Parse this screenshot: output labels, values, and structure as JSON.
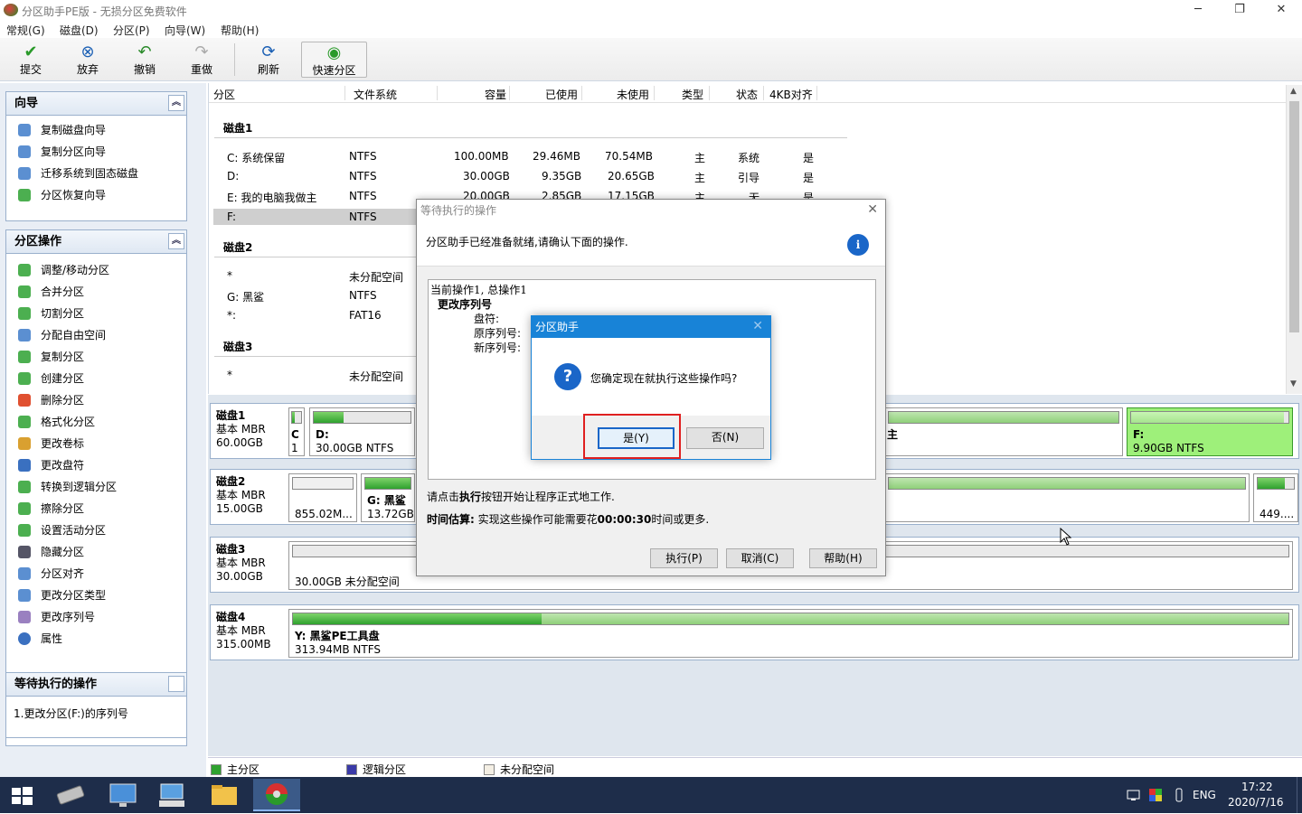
{
  "window": {
    "title": "分区助手PE版 - 无损分区免费软件",
    "minimize": "─",
    "restore": "❐",
    "close": "✕"
  },
  "menu": [
    "常规(G)",
    "磁盘(D)",
    "分区(P)",
    "向导(W)",
    "帮助(H)"
  ],
  "toolbar": {
    "commit": "提交",
    "discard": "放弃",
    "undo": "撤销",
    "redo": "重做",
    "refresh": "刷新",
    "quick": "快速分区"
  },
  "wizard": {
    "title": "向导",
    "items": [
      "复制磁盘向导",
      "复制分区向导",
      "迁移系统到固态磁盘",
      "分区恢复向导"
    ]
  },
  "partops": {
    "title": "分区操作",
    "items": [
      "调整/移动分区",
      "合并分区",
      "切割分区",
      "分配自由空间",
      "复制分区",
      "创建分区",
      "删除分区",
      "格式化分区",
      "更改卷标",
      "更改盘符",
      "转换到逻辑分区",
      "擦除分区",
      "设置活动分区",
      "隐藏分区",
      "分区对齐",
      "更改分区类型",
      "更改序列号",
      "属性"
    ]
  },
  "pending": {
    "title": "等待执行的操作",
    "items": [
      "1.更改分区(F:)的序列号"
    ]
  },
  "table": {
    "headers": [
      "分区",
      "文件系统",
      "容量",
      "已使用",
      "未使用",
      "类型",
      "状态",
      "4KB对齐"
    ],
    "disk1": {
      "title": "磁盘1",
      "rows": [
        [
          "C: 系统保留",
          "NTFS",
          "100.00MB",
          "29.46MB",
          "70.54MB",
          "主",
          "系统",
          "是"
        ],
        [
          "D:",
          "NTFS",
          "30.00GB",
          "9.35GB",
          "20.65GB",
          "主",
          "引导",
          "是"
        ],
        [
          "E: 我的电脑我做主",
          "NTFS",
          "20.00GB",
          "2.85GB",
          "17.15GB",
          "主",
          "无",
          "是"
        ],
        [
          "F:",
          "NTFS"
        ]
      ]
    },
    "disk2": {
      "title": "磁盘2",
      "rows": [
        [
          "*",
          "未分配空间"
        ],
        [
          "G: 黑鲨",
          "NTFS"
        ],
        [
          "*:",
          "FAT16"
        ]
      ]
    },
    "disk3": {
      "title": "磁盘3",
      "rows": [
        [
          "*",
          "未分配空间"
        ]
      ]
    }
  },
  "map": {
    "disk1": {
      "name": "磁盘1",
      "type": "基本 MBR",
      "size": "60.00GB",
      "c_label": "C",
      "c_size": "1",
      "d_label": "D:",
      "d_size": "30.00GB NTFS",
      "e_suffix": "主",
      "f_label": "F:",
      "f_size": "9.90GB NTFS",
      "d_used": 0.31,
      "f_used": 0.97
    },
    "disk2": {
      "name": "磁盘2",
      "type": "基本 MBR",
      "size": "15.00GB",
      "a_size": "855.02M...",
      "g_label": "G: 黑鲨",
      "g_size": "13.72GB",
      "last": "449...."
    },
    "disk3": {
      "name": "磁盘3",
      "type": "基本 MBR",
      "size": "30.00GB",
      "a_size": "30.00GB 未分配空间"
    },
    "disk4": {
      "name": "磁盘4",
      "type": "基本 MBR",
      "size": "315.00MB",
      "y_label": "Y: 黑鲨PE工具盘",
      "y_size": "313.94MB NTFS",
      "y_used": 0.25
    }
  },
  "legend": {
    "primary": "主分区",
    "logical": "逻辑分区",
    "unalloc": "未分配空间"
  },
  "colors": {
    "primary": "#2fa22f",
    "logical": "#3a3aa8",
    "accent": "#1883d7",
    "highlight": "#e02020"
  },
  "dialog1": {
    "title": "等待执行的操作",
    "msg": "分区助手已经准备就绪,请确认下面的操作.",
    "detail": {
      "line1": "当前操作1, 总操作1",
      "line2": "更改序列号",
      "k1": "盘符:",
      "k2": "原序列号:",
      "k3": "新序列号:"
    },
    "hint_pre": "请点击",
    "hint_bold": "执行",
    "hint_post": "按钮开始让程序正式地工作.",
    "est_label": "时间估算:",
    "est_pre": " 实现这些操作可能需要花",
    "est_time": "00:00:30",
    "est_post": "时间或更多.",
    "execute": "执行(P)",
    "cancel": "取消(C)",
    "help": "帮助(H)"
  },
  "dialog2": {
    "title": "分区助手",
    "question": "您确定现在就执行这些操作吗?",
    "yes": "是(Y)",
    "no": "否(N)"
  },
  "taskbar": {
    "lang": "ENG",
    "time": "17:22",
    "date": "2020/7/16"
  }
}
